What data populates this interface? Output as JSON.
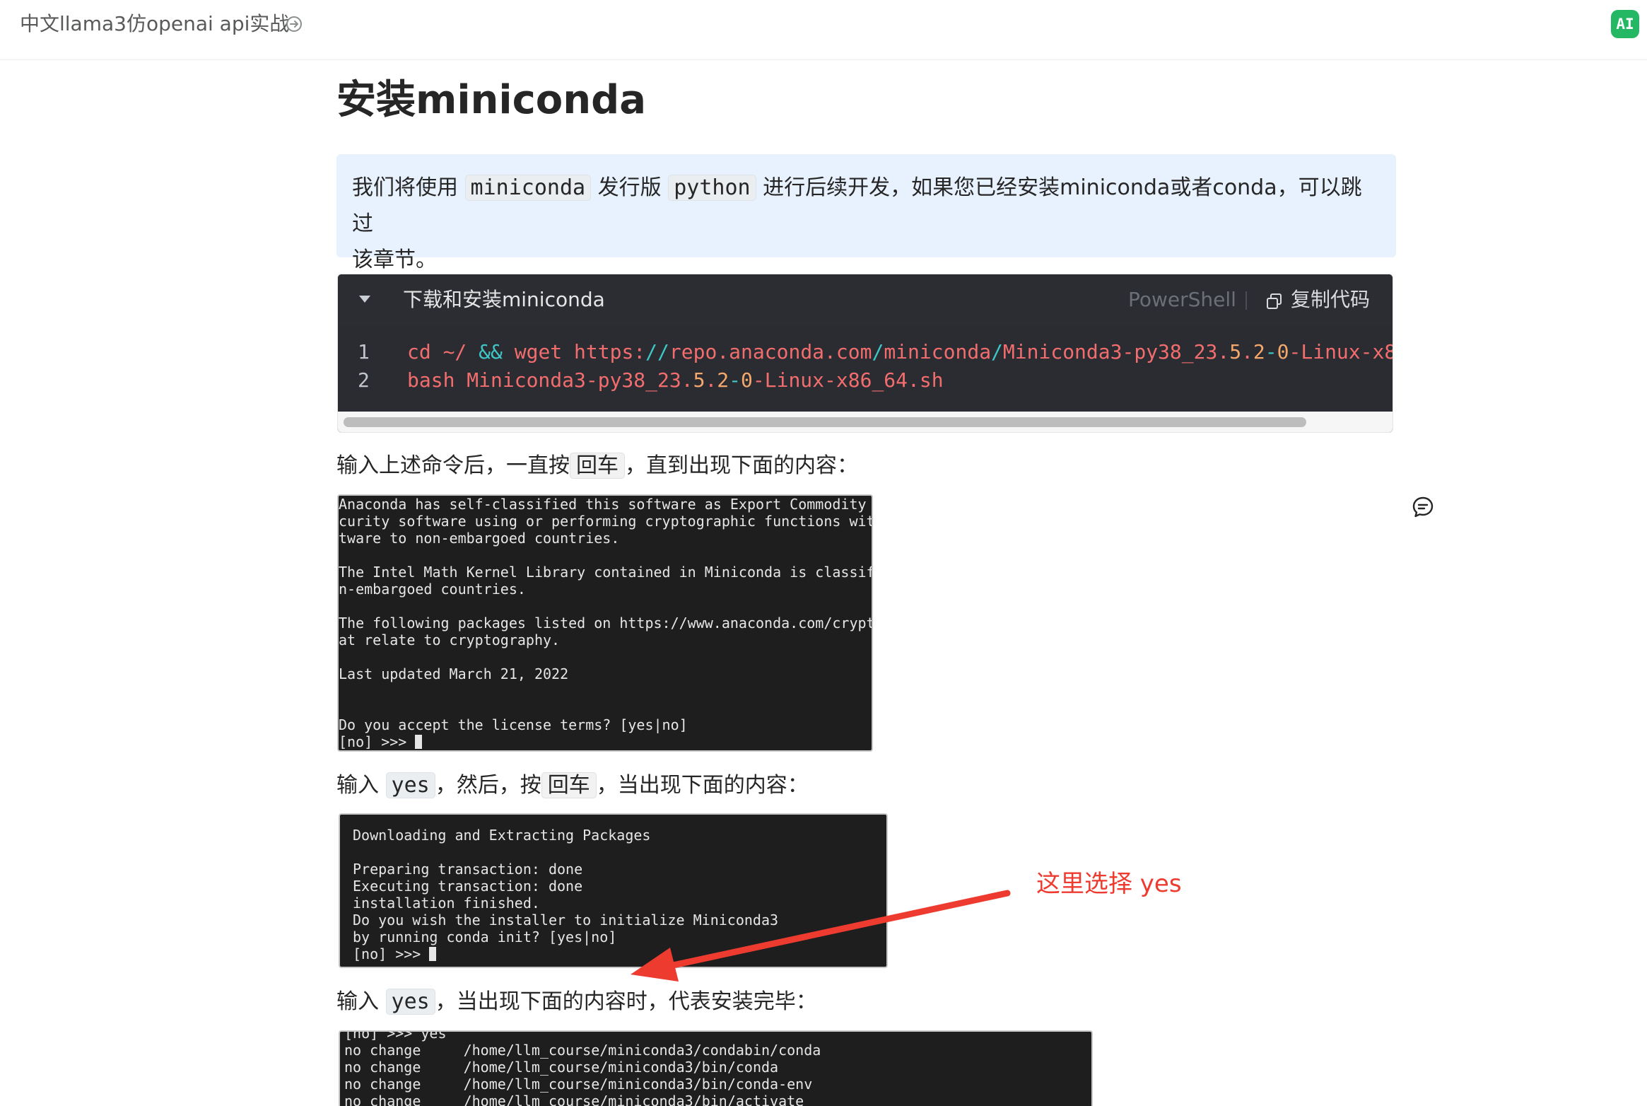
{
  "header": {
    "doc_title": "中文llama3仿openai api实战",
    "ai_badge": "AI"
  },
  "article": {
    "heading": "安装miniconda",
    "note": {
      "t1": "我们将使用",
      "c1": "miniconda",
      "t2": "发行版",
      "c2": "python",
      "t3": "进行后续开发，如果您已经安装miniconda或者conda，可以跳过",
      "t4": "该章节。"
    },
    "code_block": {
      "title": "下载和安装miniconda",
      "language": "PowerShell",
      "copy_label": "复制代码",
      "lines": [
        {
          "number": "1",
          "tokens": [
            {
              "text": "cd ~/ ",
              "kind": "cmd"
            },
            {
              "text": "&&",
              "kind": "op"
            },
            {
              "text": " wget https:",
              "kind": "cmd"
            },
            {
              "text": "//",
              "kind": "op"
            },
            {
              "text": "repo.anaconda.com",
              "kind": "cmd"
            },
            {
              "text": "/",
              "kind": "op"
            },
            {
              "text": "miniconda",
              "kind": "cmd"
            },
            {
              "text": "/",
              "kind": "op"
            },
            {
              "text": "Miniconda3-py38_23.",
              "kind": "cmd"
            },
            {
              "text": "5",
              "kind": "str"
            },
            {
              "text": ".",
              "kind": "cmd"
            },
            {
              "text": "2",
              "kind": "str"
            },
            {
              "text": "-",
              "kind": "op"
            },
            {
              "text": "0",
              "kind": "str"
            },
            {
              "text": "-Linux-x8",
              "kind": "cmd"
            }
          ]
        },
        {
          "number": "2",
          "tokens": [
            {
              "text": "bash Miniconda3-py38_23.",
              "kind": "cmd"
            },
            {
              "text": "5",
              "kind": "str"
            },
            {
              "text": ".",
              "kind": "cmd"
            },
            {
              "text": "2",
              "kind": "str"
            },
            {
              "text": "-",
              "kind": "op"
            },
            {
              "text": "0",
              "kind": "str"
            },
            {
              "text": "-Linux-x86_64.sh",
              "kind": "cmd"
            }
          ]
        }
      ]
    },
    "step1": {
      "t1": "输入上述命令后，一直按",
      "key": "回车",
      "t2": "，直到出现下面的内容："
    },
    "terminal1": [
      "Anaconda has self-classified this software as Export Commodity",
      "curity software using or performing cryptographic functions wit",
      "tware to non-embargoed countries.",
      "",
      "The Intel Math Kernel Library contained in Miniconda is classif",
      "n-embargoed countries.",
      "",
      "The following packages listed on https://www.anaconda.com/crypt",
      "at relate to cryptography.",
      "",
      "Last updated March 21, 2022",
      "",
      "",
      "Do you accept the license terms? [yes|no]",
      "[no] >>> "
    ],
    "step2": {
      "t1": "输入",
      "code": "yes",
      "t2": "，然后，按",
      "key": "回车",
      "t3": "，当出现下面的内容："
    },
    "terminal2": [
      "Downloading and Extracting Packages",
      "",
      "Preparing transaction: done",
      "Executing transaction: done",
      "installation finished.",
      "Do you wish the installer to initialize Miniconda3",
      "by running conda init? [yes|no]",
      "[no] >>> "
    ],
    "annotation": "这里选择 yes",
    "step3": {
      "t1": "输入",
      "code": "yes",
      "t2": "，当出现下面的内容时，代表安装完毕："
    },
    "terminal3": [
      "[no] >>> yes",
      "no change     /home/llm_course/miniconda3/condabin/conda",
      "no change     /home/llm_course/miniconda3/bin/conda",
      "no change     /home/llm_course/miniconda3/bin/conda-env",
      "no change     /home/llm_course/miniconda3/bin/activate"
    ]
  },
  "icons": {
    "share": "share-icon",
    "copy": "copy-icon",
    "caret": "collapse-caret-icon",
    "comment": "comment-icon"
  },
  "colors": {
    "accent_green": "#25b864",
    "note_bg": "#e8f2fe",
    "code_bg": "#2b2d33",
    "annotation_red": "#ee3b30"
  }
}
